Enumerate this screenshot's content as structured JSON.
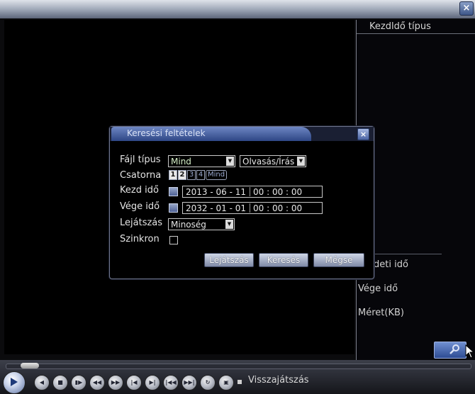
{
  "right_panel": {
    "header": "Kezdldő típus",
    "start_time_label": "deti idő",
    "end_time_label": "Vége idő",
    "size_label": "Méret(KB)"
  },
  "dialog": {
    "title": "Keresési feltételek",
    "file_type_label": "Fájl típus",
    "file_type_value": "Mind",
    "access_value": "Olvasás/Írás",
    "channel_label": "Csatorna",
    "channels": [
      "1",
      "2",
      "3",
      "4"
    ],
    "channels_all": "Mind",
    "start_label": "Kezd idő",
    "start_date": "2013 - 06 - 11",
    "start_time": "00 : 00 : 00",
    "end_label": "Vége idő",
    "end_date": "2032 - 01 - 01",
    "end_time": "00 : 00 : 00",
    "playback_label": "Lejátszás",
    "quality_value": "Minoség",
    "sync_label": "Szinkron",
    "btn_play": "Lejátszás",
    "btn_search": "Keresés",
    "btn_cancel": "Mégse"
  },
  "controls": {
    "status_label": "Visszajátszás",
    "progress_fraction": 0.03
  },
  "icons": {
    "window_close": "×",
    "dialog_close": "×",
    "arrow": "▼"
  }
}
